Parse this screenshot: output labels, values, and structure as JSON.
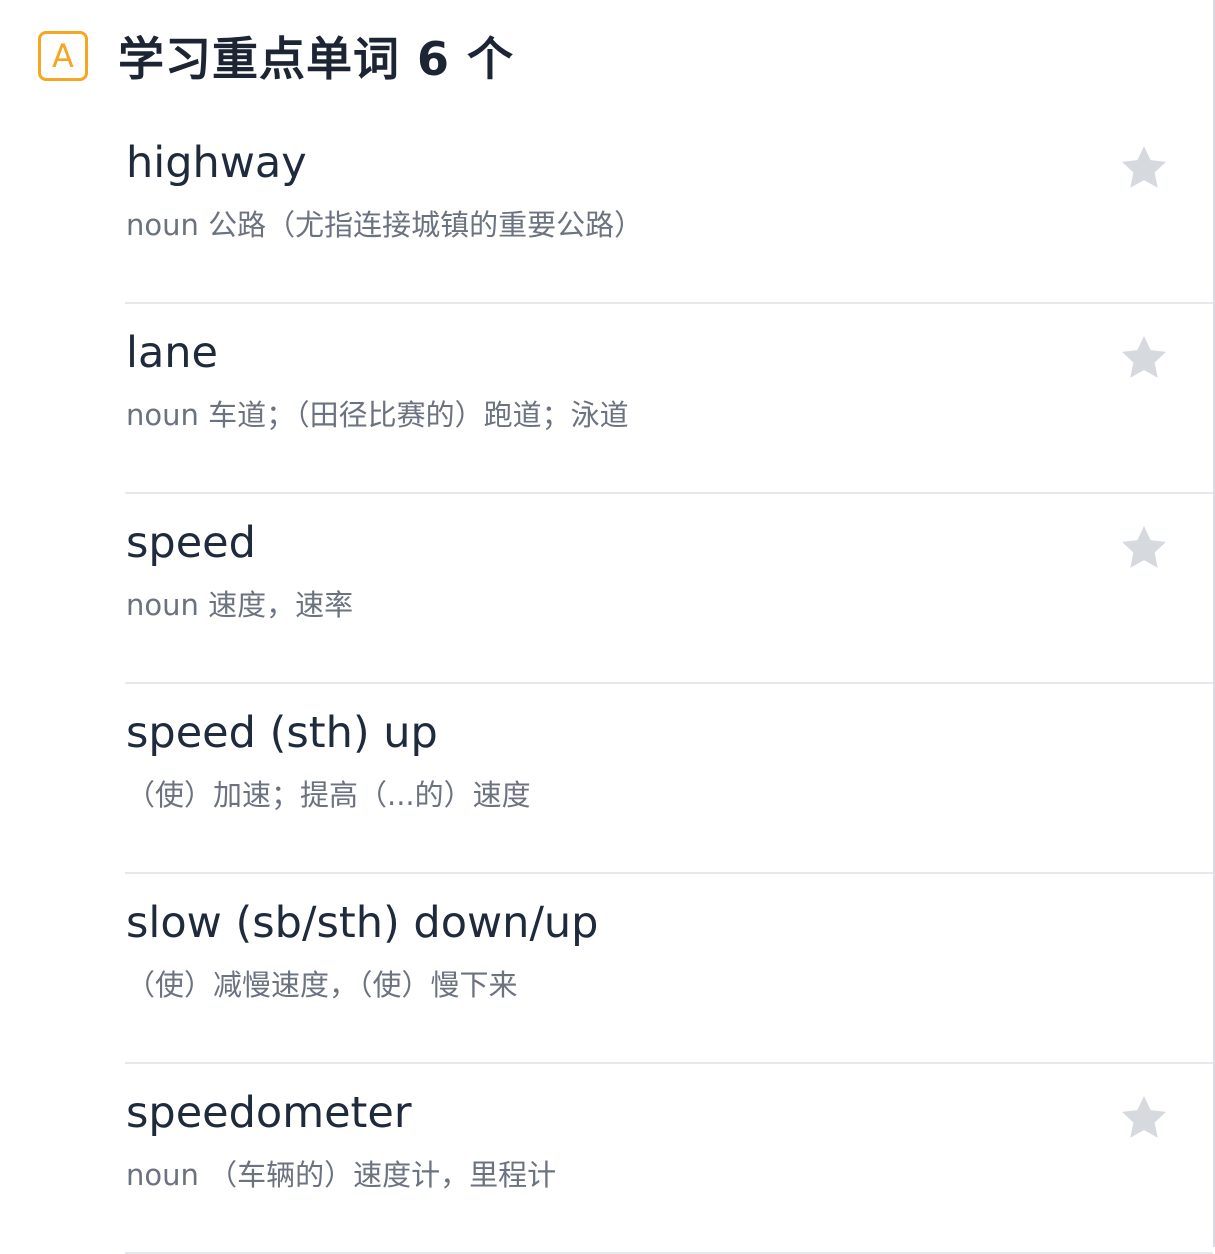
{
  "header": {
    "badge_letter": "A",
    "title": "学习重点单词 6 个"
  },
  "words": [
    {
      "term": "highway",
      "definition": "noun 公路（尤指连接城镇的重要公路）",
      "starred": true
    },
    {
      "term": "lane",
      "definition": "noun 车道；（田径比赛的）跑道；泳道",
      "starred": true
    },
    {
      "term": "speed",
      "definition": "noun 速度，速率",
      "starred": true
    },
    {
      "term": "speed (sth) up",
      "definition": "（使）加速；提高（...的）速度",
      "starred": false
    },
    {
      "term": "slow (sb/sth) down/up",
      "definition": "（使）减慢速度，（使）慢下来",
      "starred": false
    },
    {
      "term": "speedometer",
      "definition": "noun （车辆的）速度计，里程计",
      "starred": true
    }
  ],
  "colors": {
    "badge": "#f5a623",
    "title": "#1d2433",
    "star": "#d6d9de",
    "divider": "#e6e8ec"
  },
  "icons": {
    "badge": "letter-a-badge-icon",
    "favorite": "star-icon"
  }
}
